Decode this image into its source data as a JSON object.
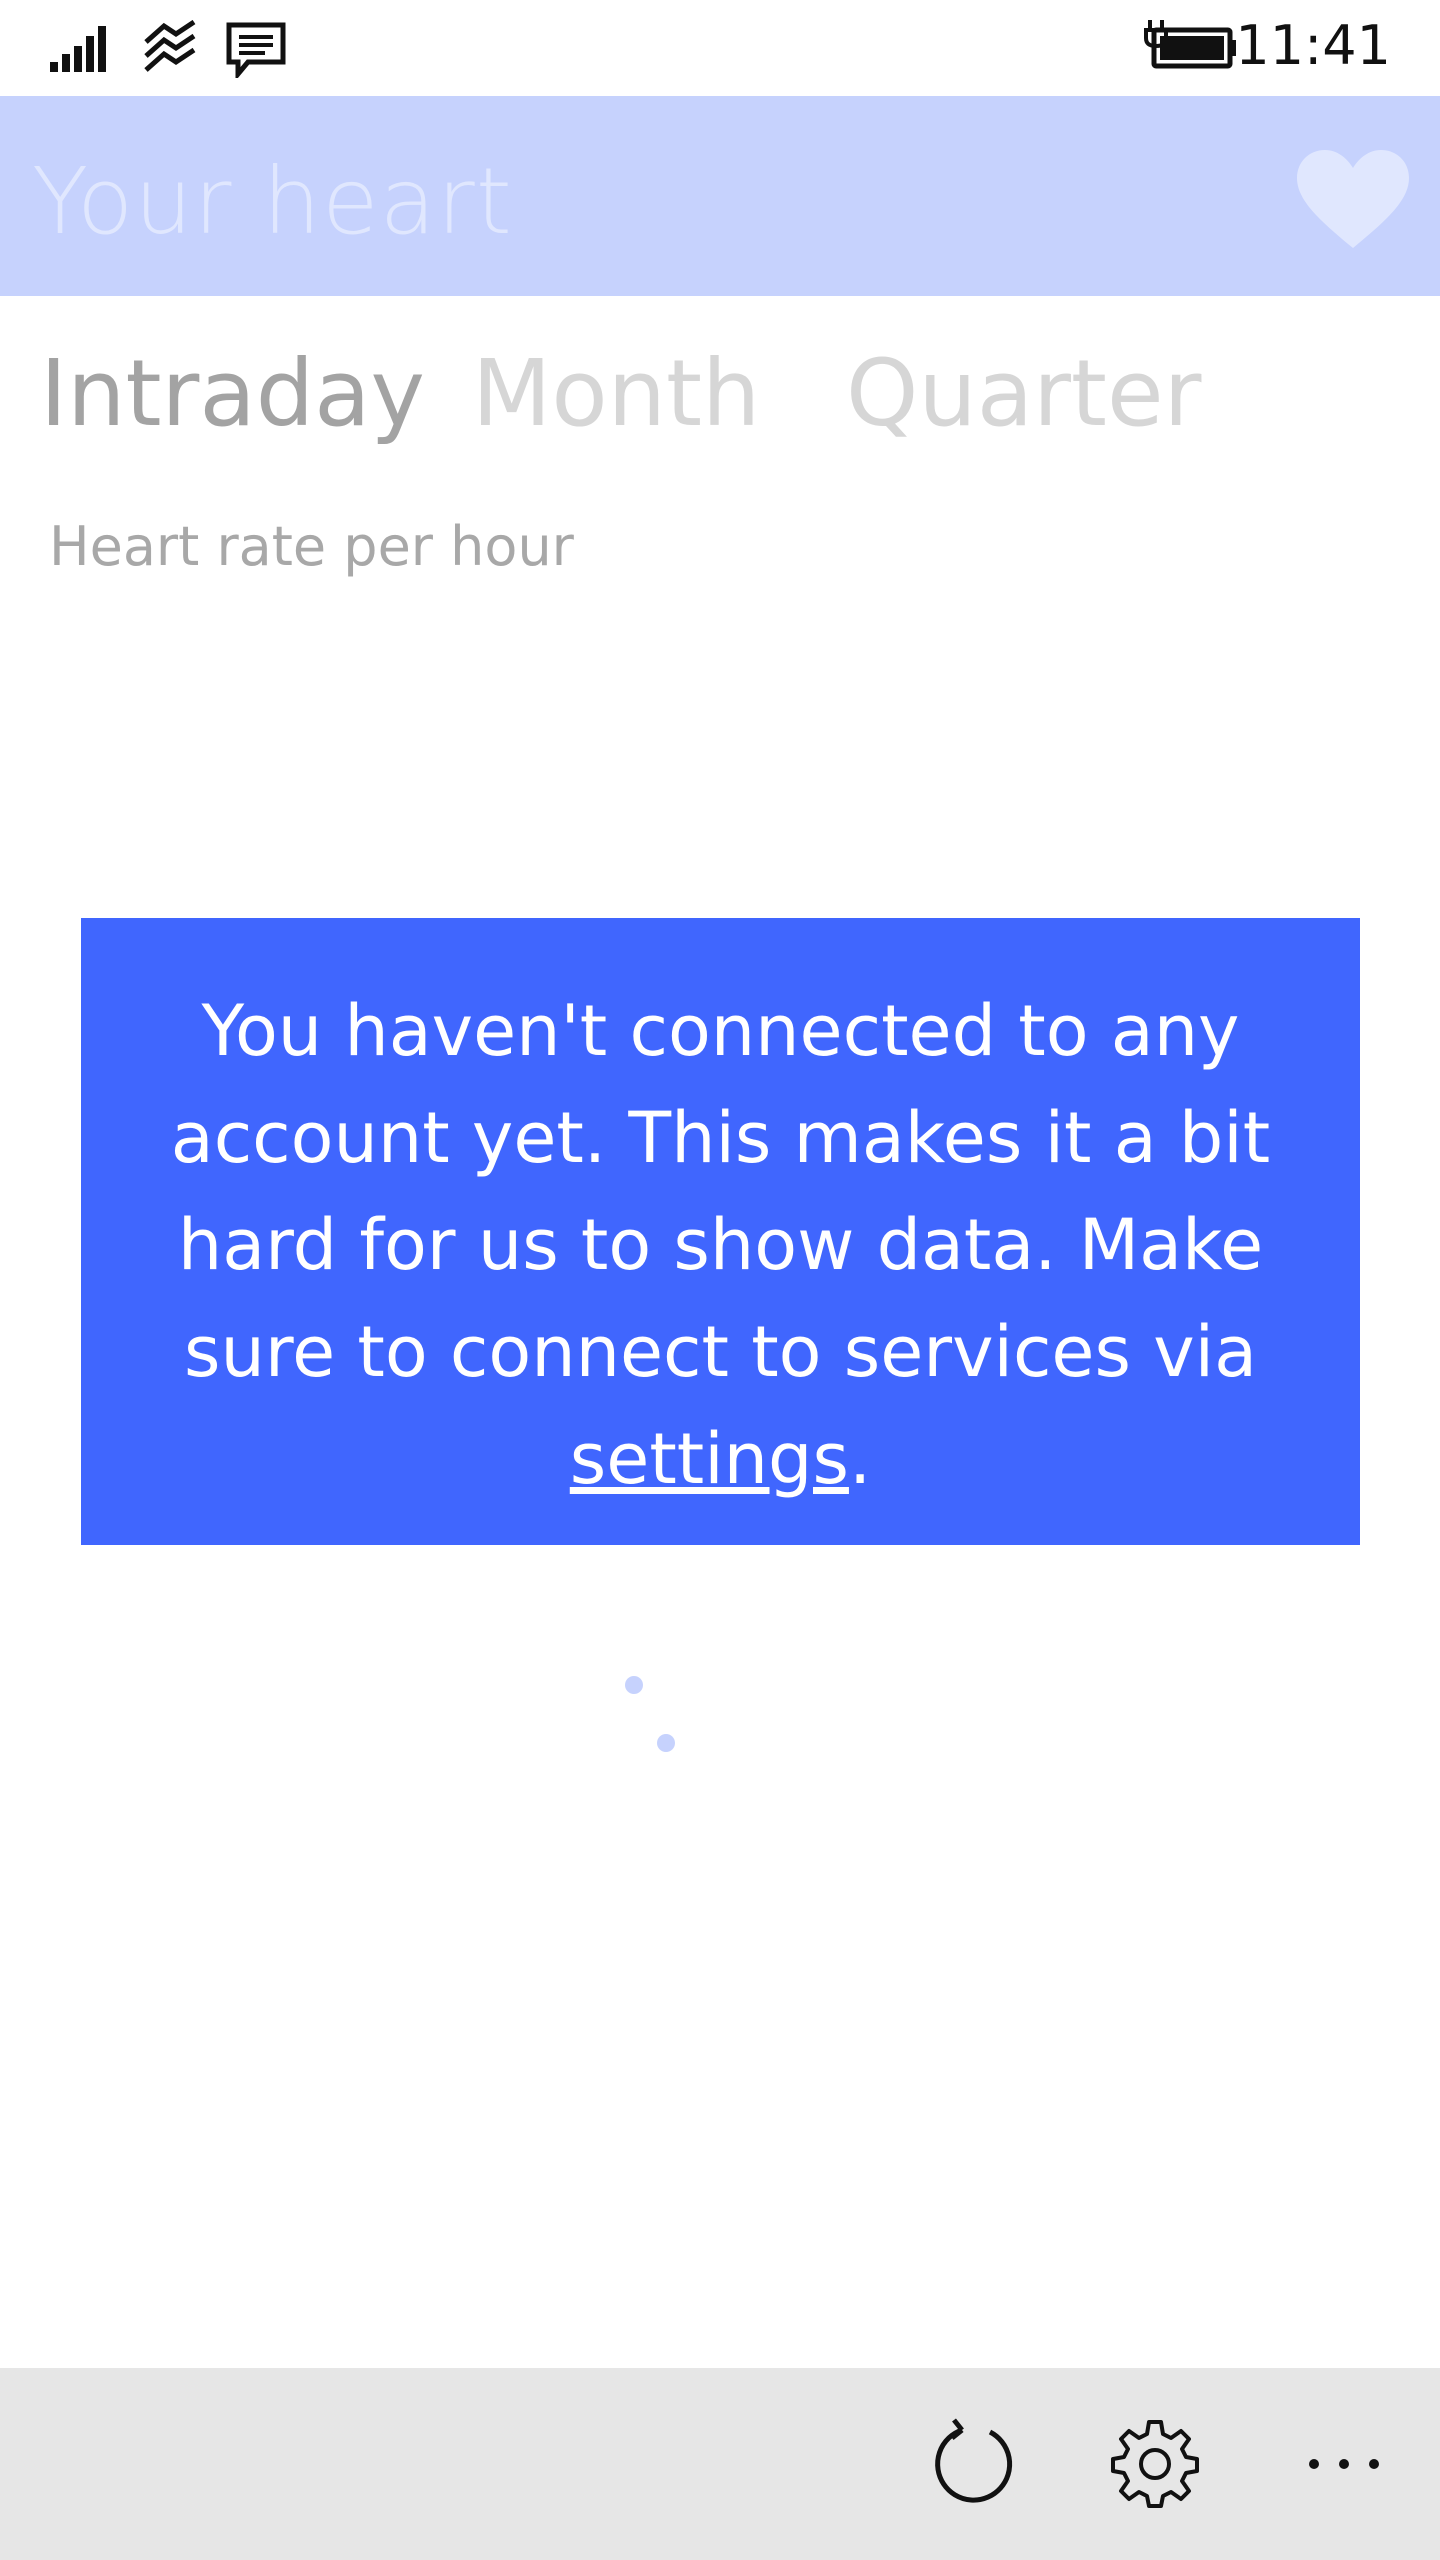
{
  "status_bar": {
    "time": "11:41",
    "icons": [
      "signal-icon",
      "wifi-icon",
      "message-icon",
      "battery-charging-icon"
    ]
  },
  "header": {
    "title": "Your heart",
    "icon": "heart-icon",
    "colors": {
      "background": "#c6d2fd",
      "title": "#e0e7fe"
    }
  },
  "tabs": [
    {
      "label": "Intraday",
      "active": true
    },
    {
      "label": "Month",
      "active": false
    },
    {
      "label": "Quarter",
      "active": false
    }
  ],
  "subtitle": "Heart rate per hour",
  "message": {
    "text_before": "You haven't connected to any account yet. This makes it a bit hard for us to show data. Make sure to connect to services via ",
    "link_text": "settings",
    "text_after": ".",
    "background": "#4066fe"
  },
  "app_bar": {
    "buttons": [
      "refresh-icon",
      "settings-gear-icon",
      "more-icon"
    ]
  }
}
